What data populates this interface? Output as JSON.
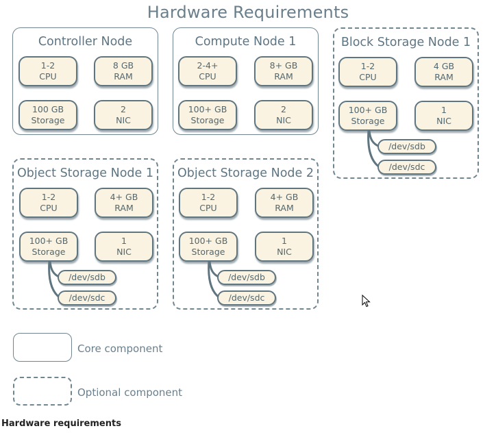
{
  "title": "Hardware Requirements",
  "nodes": [
    {
      "name": "Controller Node",
      "type": "core",
      "components": [
        {
          "value": "1-2",
          "unit": "CPU"
        },
        {
          "value": "8 GB",
          "unit": "RAM"
        },
        {
          "value": "100 GB",
          "unit": "Storage"
        },
        {
          "value": "2",
          "unit": "NIC"
        }
      ],
      "disks": []
    },
    {
      "name": "Compute Node 1",
      "type": "core",
      "components": [
        {
          "value": "2-4+",
          "unit": "CPU"
        },
        {
          "value": "8+ GB",
          "unit": "RAM"
        },
        {
          "value": "100+ GB",
          "unit": "Storage"
        },
        {
          "value": "2",
          "unit": "NIC"
        }
      ],
      "disks": []
    },
    {
      "name": "Block Storage Node 1",
      "type": "optional",
      "components": [
        {
          "value": "1-2",
          "unit": "CPU"
        },
        {
          "value": "4 GB",
          "unit": "RAM"
        },
        {
          "value": "100+ GB",
          "unit": "Storage"
        },
        {
          "value": "1",
          "unit": "NIC"
        }
      ],
      "disks": [
        "/dev/sdb",
        "/dev/sdc"
      ]
    },
    {
      "name": "Object Storage Node 1",
      "type": "optional",
      "components": [
        {
          "value": "1-2",
          "unit": "CPU"
        },
        {
          "value": "4+ GB",
          "unit": "RAM"
        },
        {
          "value": "100+ GB",
          "unit": "Storage"
        },
        {
          "value": "1",
          "unit": "NIC"
        }
      ],
      "disks": [
        "/dev/sdb",
        "/dev/sdc"
      ]
    },
    {
      "name": "Object Storage Node 2",
      "type": "optional",
      "components": [
        {
          "value": "1-2",
          "unit": "CPU"
        },
        {
          "value": "4+ GB",
          "unit": "RAM"
        },
        {
          "value": "100+ GB",
          "unit": "Storage"
        },
        {
          "value": "1",
          "unit": "NIC"
        }
      ],
      "disks": [
        "/dev/sdb",
        "/dev/sdc"
      ]
    }
  ],
  "legend": {
    "core_label": "Core component",
    "optional_label": "Optional component"
  },
  "caption": "Hardware requirements",
  "colors": {
    "border": "#6f8590",
    "component_fill": "#faf3e1",
    "text": "#5e7583"
  }
}
